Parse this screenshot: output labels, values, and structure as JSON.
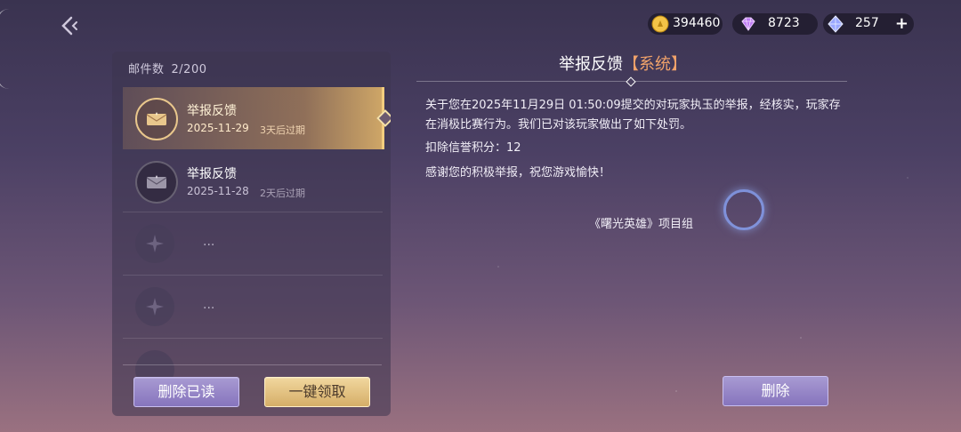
{
  "currency": {
    "gold": "394460",
    "purple": "8723",
    "blue": "257",
    "plus": "+"
  },
  "mailbox": {
    "count_label": "邮件数",
    "count_value": "2/200",
    "items": [
      {
        "title": "举报反馈",
        "date": "2025-11-29",
        "expires": "3天后过期"
      },
      {
        "title": "举报反馈",
        "date": "2025-11-28",
        "expires": "2天后过期"
      }
    ],
    "placeholder_text": "..."
  },
  "buttons": {
    "delete_read": "删除已读",
    "claim_all": "一键领取",
    "delete": "删除"
  },
  "content": {
    "title": "举报反馈",
    "tag": "【系统】",
    "paragraph1": "关于您在2025年11月29日 01:50:09提交的对玩家执玉的举报，经核实，玩家存在消极比赛行为。我们已对该玩家做出了如下处罚。",
    "paragraph2": "扣除信誉积分：12",
    "paragraph3": "感谢您的积极举报，祝您游戏愉快！",
    "signature": "《曙光英雄》项目组"
  },
  "colors": {
    "accent_gold": "#f2cd7e",
    "tag_orange": "#f0a26a",
    "button_purple": "#8674bd"
  }
}
